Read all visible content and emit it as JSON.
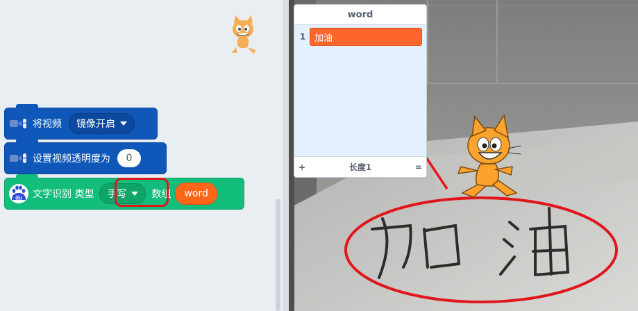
{
  "blocks": {
    "video_toggle": {
      "label": "将视频",
      "dropdown_value": "镜像开启"
    },
    "video_transparency": {
      "label": "设置视频透明度为",
      "value": "0"
    },
    "text_recognition": {
      "icon_label": "du",
      "label": "文字识别 类型",
      "type_value": "手写",
      "suffix": "数组",
      "variable": "word"
    }
  },
  "list_monitor": {
    "title": "word",
    "items": [
      {
        "index": "1",
        "value": "加油"
      }
    ],
    "footer_add": "+",
    "footer_length": "长度1",
    "footer_resize": "="
  },
  "stage_text": {
    "handwriting": "加 油"
  },
  "colors": {
    "video_block": "#0f57b8",
    "extension_block": "#13bd7c",
    "variable": "#ff661a",
    "annotation": "#e0161c"
  }
}
